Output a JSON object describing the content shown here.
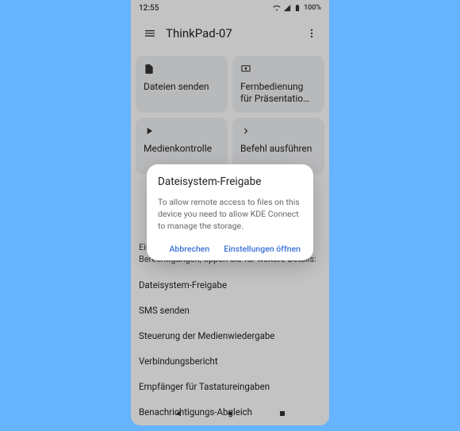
{
  "statusbar": {
    "time": "12:55",
    "battery": "100%"
  },
  "appbar": {
    "title": "ThinkPad-07"
  },
  "cards": [
    {
      "label": "Dateien senden",
      "icon": "file"
    },
    {
      "label": "Fernbedienung für Präsentatio…",
      "icon": "present"
    },
    {
      "label": "Medienkontrolle",
      "icon": "play"
    },
    {
      "label": "Befehl ausführen",
      "icon": "chevron"
    }
  ],
  "section_hint": "Einige Plugins benötigen zusätzliche Berechtigungen; tippen Sie für weitere Details:",
  "perms": [
    "Dateisystem-Freigabe",
    "SMS senden",
    "Steuerung der Medienwiedergabe",
    "Verbindungsbericht",
    "Empfänger für Tastatureingaben",
    "Benachrichtigungs-Abgleich"
  ],
  "dialog": {
    "title": "Dateisystem-Freigabe",
    "body": "To allow remote access to files on this device you need to allow KDE Connect to manage the storage.",
    "cancel": "Abbrechen",
    "confirm": "Einstellungen öffnen"
  }
}
